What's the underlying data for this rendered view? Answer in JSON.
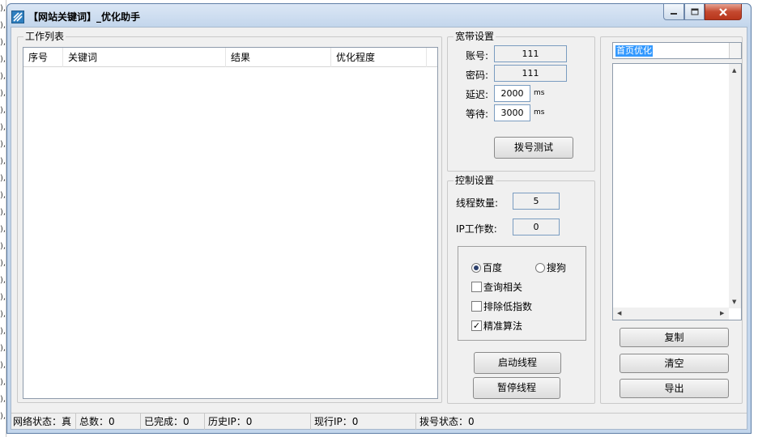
{
  "window": {
    "title": "【网站关键词】_优化助手"
  },
  "task_list": {
    "legend": "工作列表",
    "columns": [
      "序号",
      "关键词",
      "结果",
      "优化程度"
    ]
  },
  "broadband": {
    "legend": "宽带设置",
    "account_label": "账号:",
    "account_value": "111",
    "password_label": "密码:",
    "password_value": "111",
    "delay_label": "延迟:",
    "delay_value": "2000",
    "delay_unit": "ms",
    "wait_label": "等待:",
    "wait_value": "3000",
    "wait_unit": "ms",
    "dial_test_button": "拨号测试"
  },
  "control": {
    "legend": "控制设置",
    "threads_label": "线程数量:",
    "threads_value": "5",
    "ip_work_label": "IP工作数:",
    "ip_work_value": "0",
    "engine_baidu": "百度",
    "engine_sogou": "搜狗",
    "opt_related": "查询相关",
    "opt_low_index": "排除低指数",
    "opt_precise": "精准算法",
    "start_button": "启动线程",
    "pause_button": "暂停线程"
  },
  "right_panel": {
    "mode_selected": "首页优化",
    "copy_button": "复制",
    "clear_button": "清空",
    "export_button": "导出"
  },
  "status": {
    "network": "网络状态：真",
    "total": "总数：0",
    "completed": "已完成：0",
    "history_ip": "历史IP：0",
    "current_ip": "现行IP：0",
    "dial_status": "拨号状态：0"
  },
  "colors": {
    "title_gradient_top": "#dbe7f5",
    "title_gradient_bottom": "#c3d6ec",
    "client_bg": "#f0f0f0",
    "selection": "#3399ff",
    "close_button": "#c4492f"
  }
}
